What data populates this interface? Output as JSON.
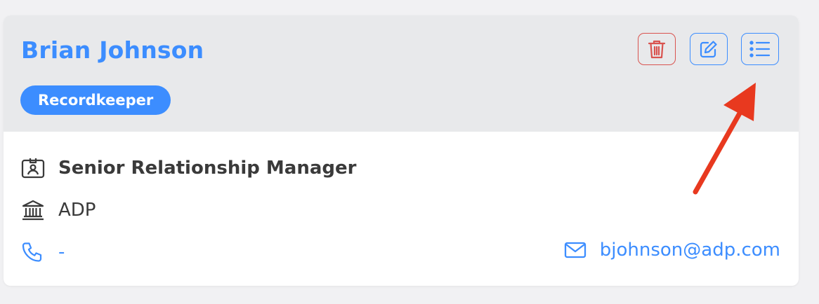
{
  "contact": {
    "name": "Brian Johnson",
    "role": "Recordkeeper",
    "title": "Senior Relationship Manager",
    "organization": "ADP",
    "phone": "-",
    "email": "bjohnson@adp.com"
  },
  "icons": {
    "delete": "trash-icon",
    "edit": "pencil-square-icon",
    "list": "list-icon",
    "title": "id-badge-icon",
    "organization": "bank-building-icon",
    "phone": "phone-icon",
    "email": "envelope-icon"
  },
  "colors": {
    "accent": "#3c8dff",
    "danger": "#d9534f",
    "header_bg": "#e8e9eb",
    "text": "#3a3a3a",
    "annotation": "#e8391f"
  }
}
